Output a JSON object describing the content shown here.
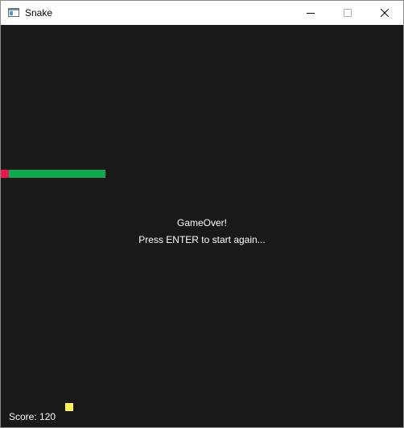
{
  "window": {
    "title": "Snake",
    "icons": {
      "app": "app-window-icon",
      "minimize": "minimize-icon",
      "maximize": "maximize-icon",
      "close": "close-icon"
    }
  },
  "game": {
    "background_color": "#191919",
    "snake_head_color": "#e8174f",
    "snake_body_color": "#0fa94f",
    "food_color": "#fff458",
    "message_line1": "GameOver!",
    "message_line2": "Press ENTER to start again...",
    "score_label": "Score:",
    "score_value": "120"
  }
}
